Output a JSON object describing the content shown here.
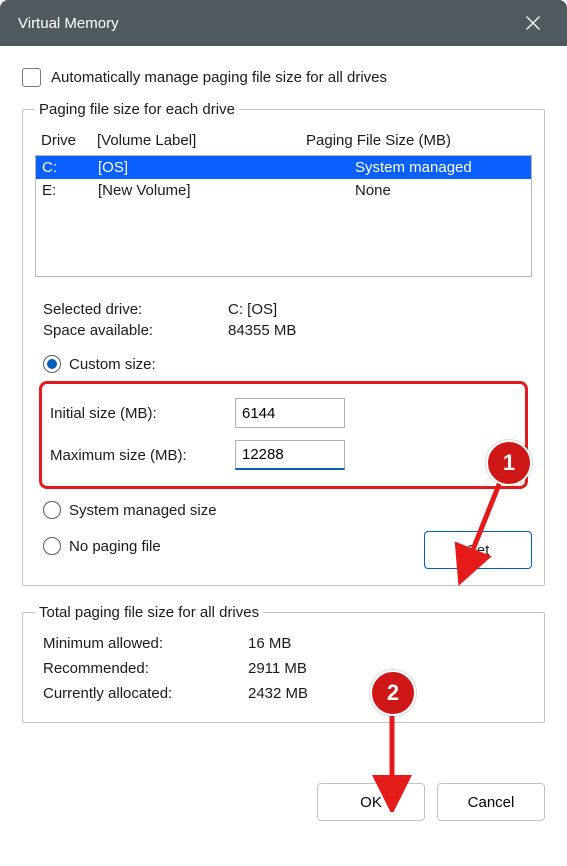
{
  "window": {
    "title": "Virtual Memory"
  },
  "autoManage": {
    "label": "Automatically manage paging file size for all drives"
  },
  "driveGroup": {
    "legend": "Paging file size for each drive",
    "headers": {
      "drive": "Drive",
      "label": "[Volume Label]",
      "size": "Paging File Size (MB)"
    },
    "rows": [
      {
        "drive": "C:",
        "label": "[OS]",
        "size": "System managed",
        "selected": true
      },
      {
        "drive": "E:",
        "label": "[New Volume]",
        "size": "None",
        "selected": false
      }
    ],
    "selectedDrive": {
      "label": "Selected drive:",
      "value": "C:  [OS]"
    },
    "spaceAvailable": {
      "label": "Space available:",
      "value": "84355 MB"
    },
    "options": {
      "custom": "Custom size:",
      "systemManaged": "System managed size",
      "noPaging": "No paging file"
    },
    "initial": {
      "label": "Initial size (MB):",
      "value": "6144"
    },
    "maximum": {
      "label": "Maximum size (MB):",
      "value": "12288"
    },
    "setBtn": "Set"
  },
  "totals": {
    "legend": "Total paging file size for all drives",
    "min": {
      "label": "Minimum allowed:",
      "value": "16 MB"
    },
    "rec": {
      "label": "Recommended:",
      "value": "2911 MB"
    },
    "cur": {
      "label": "Currently allocated:",
      "value": "2432 MB"
    }
  },
  "footer": {
    "ok": "OK",
    "cancel": "Cancel"
  },
  "callouts": {
    "one": "1",
    "two": "2"
  }
}
